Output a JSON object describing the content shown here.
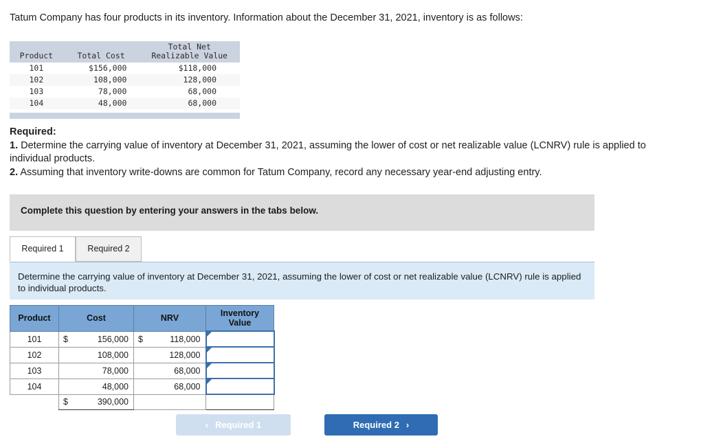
{
  "intro": "Tatum Company has four products in its inventory. Information about the December 31, 2021, inventory is as follows:",
  "data_table": {
    "headers": {
      "product": "Product",
      "total_cost": "Total Cost",
      "nrv_line1": "Total Net",
      "nrv_line2": "Realizable Value"
    },
    "rows": [
      {
        "product": "101",
        "cost": "$156,000",
        "nrv": "$118,000"
      },
      {
        "product": "102",
        "cost": "108,000",
        "nrv": "128,000"
      },
      {
        "product": "103",
        "cost": "78,000",
        "nrv": "68,000"
      },
      {
        "product": "104",
        "cost": "48,000",
        "nrv": "68,000"
      }
    ]
  },
  "required": {
    "heading": "Required:",
    "item1_num": "1.",
    "item1_text": " Determine the carrying value of inventory at December 31, 2021, assuming the lower of cost or net realizable value (LCNRV) rule is applied to individual products.",
    "item2_num": "2.",
    "item2_text": " Assuming that inventory write-downs are common for Tatum Company, record any necessary year-end adjusting entry."
  },
  "banner": {
    "text": "Complete this question by entering your answers in the tabs below."
  },
  "tabs": [
    {
      "label": "Required 1",
      "active": true
    },
    {
      "label": "Required 2",
      "active": false
    }
  ],
  "instruction_box": {
    "text": "Determine the carrying value of inventory at December 31, 2021, assuming the lower of cost or net realizable value (LCNRV) rule is applied to individual products."
  },
  "answer_table": {
    "headers": {
      "product": "Product",
      "cost": "Cost",
      "nrv": "NRV",
      "inventory_value_line1": "Inventory",
      "inventory_value_line2": "Value"
    },
    "rows": [
      {
        "product": "101",
        "cost_sym": "$",
        "cost": "156,000",
        "nrv_sym": "$",
        "nrv": "118,000",
        "inventory_value": ""
      },
      {
        "product": "102",
        "cost_sym": "",
        "cost": "108,000",
        "nrv_sym": "",
        "nrv": "128,000",
        "inventory_value": ""
      },
      {
        "product": "103",
        "cost_sym": "",
        "cost": "78,000",
        "nrv_sym": "",
        "nrv": "68,000",
        "inventory_value": ""
      },
      {
        "product": "104",
        "cost_sym": "",
        "cost": "48,000",
        "nrv_sym": "",
        "nrv": "68,000",
        "inventory_value": ""
      }
    ],
    "total": {
      "product": "",
      "cost_sym": "$",
      "cost": "390,000",
      "nrv": "",
      "inventory_value": ""
    }
  },
  "nav": {
    "prev_label": "Required 1",
    "prev_chevron": "‹",
    "next_label": "Required 2",
    "next_chevron": "›"
  },
  "colors": {
    "header_blue": "#7aa6d6",
    "info_blue": "#daeaf6",
    "banner_gray": "#dcdcdc",
    "mono_header_gray": "#ccd3e0",
    "next_button_blue": "#2f6cb3",
    "prev_button_blue": "#cfdff0",
    "input_border_blue": "#3b6fa8"
  }
}
